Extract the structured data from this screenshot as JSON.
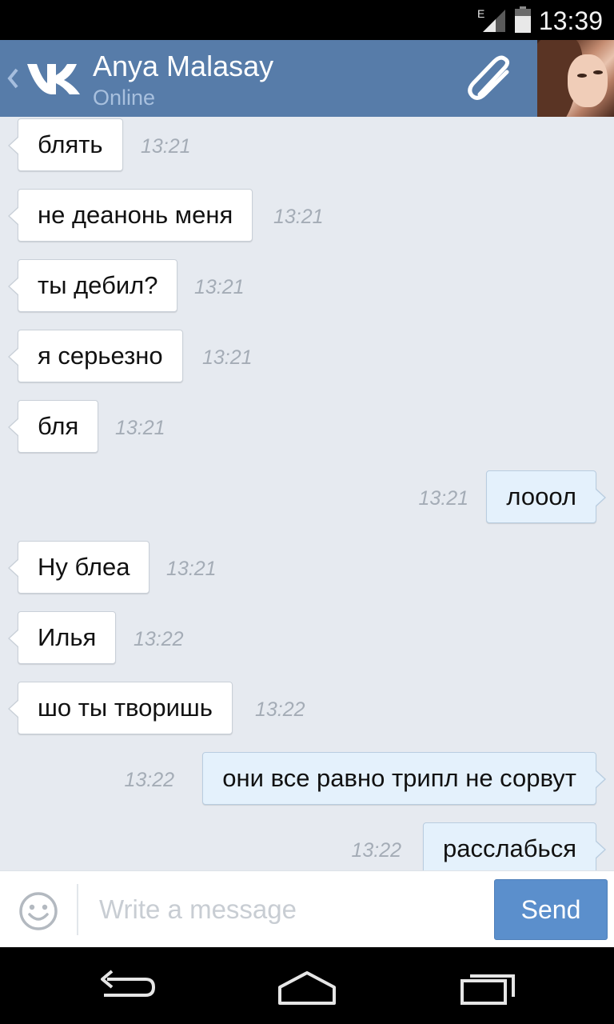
{
  "status_bar": {
    "time": "13:39",
    "network_label": "E",
    "icons": [
      "signal-icon",
      "battery-icon"
    ]
  },
  "header": {
    "contact_name": "Anya Malasay",
    "contact_status": "Online",
    "icons": [
      "back-chevron-icon",
      "vk-logo-icon",
      "paperclip-icon"
    ]
  },
  "messages": [
    {
      "direction": "in",
      "text": "блять",
      "time": "13:21"
    },
    {
      "direction": "in",
      "text": "не деанонь меня",
      "time": "13:21"
    },
    {
      "direction": "in",
      "text": "ты дебил?",
      "time": "13:21"
    },
    {
      "direction": "in",
      "text": "я серьезно",
      "time": "13:21"
    },
    {
      "direction": "in",
      "text": "бля",
      "time": "13:21"
    },
    {
      "direction": "out",
      "text": "лооол",
      "time": "13:21"
    },
    {
      "direction": "in",
      "text": "Ну блеа",
      "time": "13:21"
    },
    {
      "direction": "in",
      "text": "Илья",
      "time": "13:22"
    },
    {
      "direction": "in",
      "text": "шо ты творишь",
      "time": "13:22"
    },
    {
      "direction": "out",
      "text": "они все равно трипл не сорвут",
      "time": "13:22"
    },
    {
      "direction": "out",
      "text": "расслабься",
      "time": "13:22"
    }
  ],
  "composer": {
    "placeholder": "Write a message",
    "value": "",
    "send_label": "Send",
    "icons": [
      "smiley-icon"
    ]
  },
  "nav_bar": {
    "icons": [
      "nav-back-icon",
      "nav-home-icon",
      "nav-recent-apps-icon"
    ]
  },
  "colors": {
    "header_bg": "#577ca9",
    "chat_bg": "#e6eaf0",
    "incoming_bubble": "#ffffff",
    "outgoing_bubble": "#e4f1fc",
    "send_button": "#5b8fcc",
    "timestamp": "#a4acb6"
  }
}
